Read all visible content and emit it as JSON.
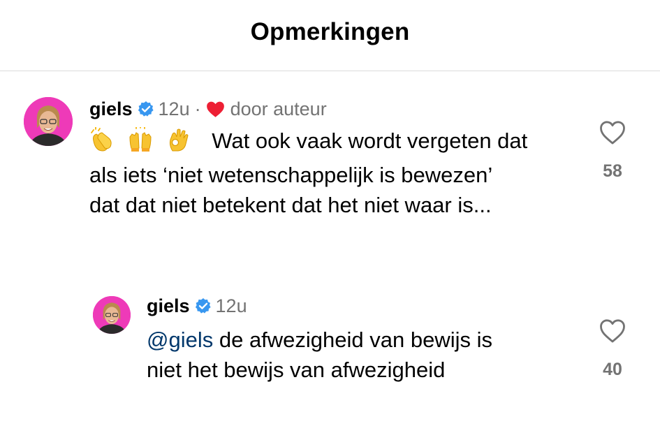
{
  "header": {
    "title": "Opmerkingen"
  },
  "comments": [
    {
      "username": "giels",
      "verified": true,
      "time": "12u",
      "separator": "·",
      "liked_by_author_label": "door auteur",
      "emojis": [
        "clapping-hands-emoji",
        "raising-hands-emoji",
        "ok-hand-emoji"
      ],
      "text_lines": [
        "Wat ook vaak wordt vergeten dat",
        "als iets ‘niet wetenschappelijk is bewezen’",
        "dat dat niet betekent dat het niet waar is..."
      ],
      "like_count": "58"
    },
    {
      "username": "giels",
      "verified": true,
      "time": "12u",
      "mention": "@giels",
      "text_lines": [
        " de afwezigheid van bewijs is",
        "niet het bewijs van afwezigheid"
      ],
      "like_count": "40"
    }
  ],
  "colors": {
    "avatar_bg": "#ee3ab8",
    "verified_blue": "#3897f0",
    "heart_red": "#ed1f34",
    "mention_blue": "#00376b",
    "secondary_text": "#737373"
  }
}
